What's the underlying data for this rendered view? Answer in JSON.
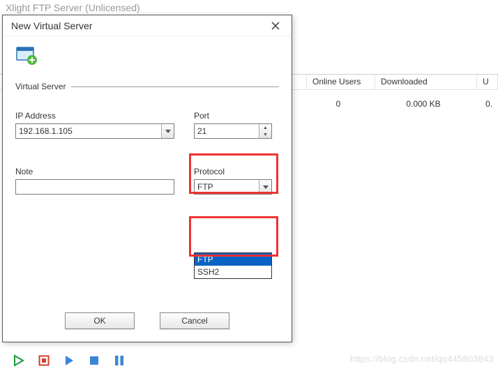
{
  "main_window_title": "Xlight FTP Server (Unlicensed)",
  "table": {
    "headers": {
      "online": "Online Users",
      "downloaded": "Downloaded",
      "u": "U"
    },
    "row": {
      "online": "0",
      "downloaded": "0.000 KB",
      "u": "0."
    }
  },
  "dialog": {
    "title": "New Virtual Server",
    "section_label": "Virtual Server",
    "ip_label": "IP Address",
    "ip_value": "192.168.1.105",
    "port_label": "Port",
    "port_value": "21",
    "note_label": "Note",
    "note_value": "",
    "protocol_label": "Protocol",
    "protocol_value": "FTP",
    "protocol_options": [
      "FTP",
      "SSH2"
    ],
    "ok": "OK",
    "cancel": "Cancel"
  },
  "watermark": "https://blog.csdn.net/qq445803843"
}
